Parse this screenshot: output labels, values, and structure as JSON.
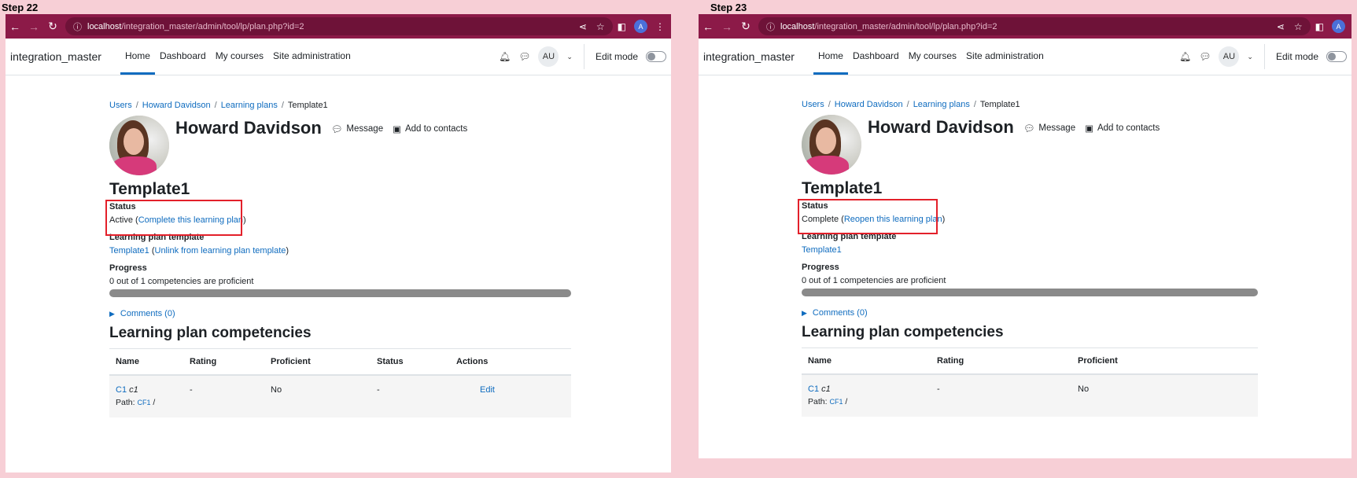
{
  "steps": [
    {
      "label": "Step 22",
      "browser": {
        "url_host": "localhost",
        "url_path": "/integration_master/admin/tool/lp/plan.php?id=2",
        "profile_initial": "A"
      },
      "site_name": "integration_master",
      "nav": [
        "Home",
        "Dashboard",
        "My courses",
        "Site administration"
      ],
      "user_initials": "AU",
      "edit_mode": "Edit mode",
      "breadcrumb": [
        "Users",
        "Howard Davidson",
        "Learning plans",
        "Template1"
      ],
      "person_name": "Howard Davidson",
      "message": "Message",
      "add_contacts": "Add to contacts",
      "plan_title": "Template1",
      "status_label": "Status",
      "status_value": "Active",
      "status_action": "Complete this learning plan",
      "template_label": "Learning plan template",
      "template_link": "Template1",
      "template_action": "Unlink from learning plan template",
      "progress_label": "Progress",
      "progress_text": "0 out of 1 competencies are proficient",
      "progress_value": 0,
      "comments": "Comments (0)",
      "competencies_title": "Learning plan competencies",
      "table": {
        "headers": [
          "Name",
          "Rating",
          "Proficient",
          "Status",
          "Actions"
        ],
        "row": {
          "code": "C1",
          "name": "c1",
          "path_label": "Path:",
          "path_link": "CF1",
          "path_sep": "/",
          "rating": "-",
          "proficient": "No",
          "status": "-",
          "action": "Edit"
        }
      }
    },
    {
      "label": "Step 23",
      "browser": {
        "url_host": "localhost",
        "url_path": "/integration_master/admin/tool/lp/plan.php?id=2",
        "profile_initial": "A"
      },
      "site_name": "integration_master",
      "nav": [
        "Home",
        "Dashboard",
        "My courses",
        "Site administration"
      ],
      "user_initials": "AU",
      "edit_mode": "Edit mode",
      "breadcrumb": [
        "Users",
        "Howard Davidson",
        "Learning plans",
        "Template1"
      ],
      "person_name": "Howard Davidson",
      "message": "Message",
      "add_contacts": "Add to contacts",
      "plan_title": "Template1",
      "status_label": "Status",
      "status_value": "Complete",
      "status_action": "Reopen this learning plan",
      "template_label": "Learning plan template",
      "template_link": "Template1",
      "progress_label": "Progress",
      "progress_text": "0 out of 1 competencies are proficient",
      "progress_value": 0,
      "comments": "Comments (0)",
      "competencies_title": "Learning plan competencies",
      "table": {
        "headers": [
          "Name",
          "Rating",
          "Proficient"
        ],
        "row": {
          "code": "C1",
          "name": "c1",
          "path_label": "Path:",
          "path_link": "CF1",
          "path_sep": "/",
          "rating": "-",
          "proficient": "No"
        }
      }
    }
  ],
  "colors": {
    "chrome": "#8c1a48",
    "link": "#0f6cbf",
    "highlight": "#e3202a",
    "progress": "#8a8a8a"
  }
}
